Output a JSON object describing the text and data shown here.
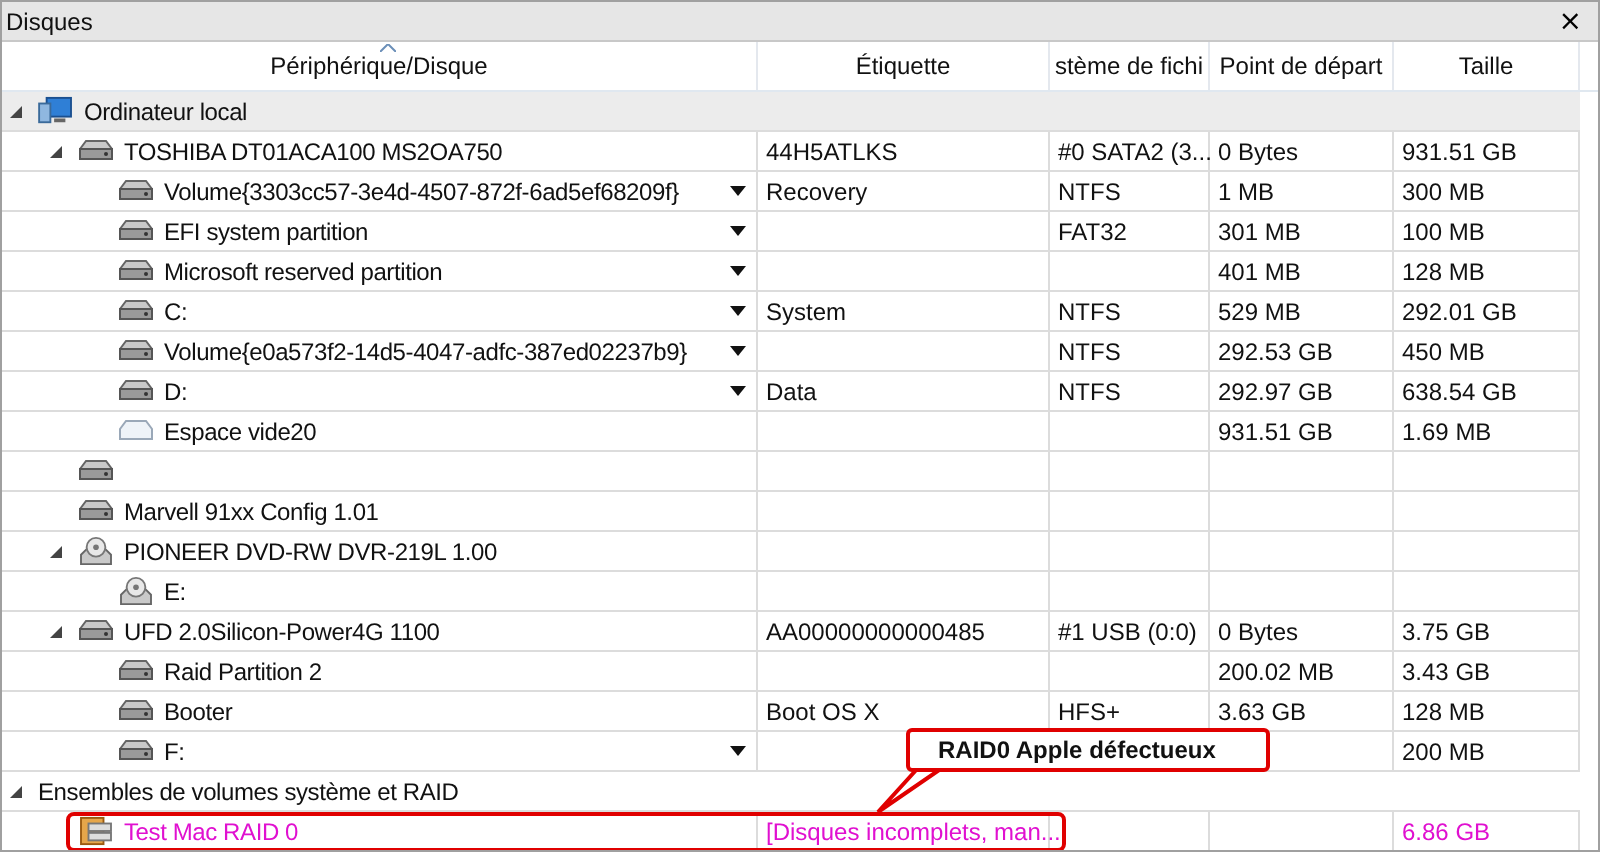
{
  "window": {
    "title": "Disques",
    "close": "×"
  },
  "columns": [
    {
      "label": "Périphérique/Disque",
      "sorted": true
    },
    {
      "label": "Étiquette",
      "sorted": false
    },
    {
      "label": "stème de fichi",
      "sorted": false
    },
    {
      "label": "Point de départ",
      "sorted": false
    },
    {
      "label": "Taille",
      "sorted": false
    }
  ],
  "tree": [
    {
      "kind": "computer",
      "name": "Ordinateur local",
      "selected": true,
      "expanded": true,
      "children": [
        {
          "kind": "disk",
          "name": "TOSHIBA DT01ACA100 MS2OA750",
          "label": "44H5ATLKS",
          "column_3": "#0 SATA2 (3...",
          "start": "0 Bytes",
          "size": "931.51 GB",
          "expanded": true,
          "children": [
            {
              "kind": "disk",
              "name": "Volume{3303cc57-3e4d-4507-872f-6ad5ef68209f}",
              "dropdown": true,
              "label": "Recovery",
              "column_3": "NTFS",
              "start": "1 MB",
              "size": "300 MB"
            },
            {
              "kind": "disk",
              "name": "EFI system partition",
              "dropdown": true,
              "column_3": "FAT32",
              "start": "301 MB",
              "size": "100 MB"
            },
            {
              "kind": "disk",
              "name": "Microsoft reserved partition",
              "dropdown": true,
              "start": "401 MB",
              "size": "128 MB"
            },
            {
              "kind": "disk",
              "name": "C:",
              "dropdown": true,
              "label": "System",
              "column_3": "NTFS",
              "start": "529 MB",
              "size": "292.01 GB"
            },
            {
              "kind": "disk",
              "name": "Volume{e0a573f2-14d5-4047-adfc-387ed02237b9}",
              "dropdown": true,
              "column_3": "NTFS",
              "start": "292.53 GB",
              "size": "450 MB"
            },
            {
              "kind": "disk",
              "name": "D:",
              "dropdown": true,
              "label": "Data",
              "column_3": "NTFS",
              "start": "292.97 GB",
              "size": "638.54 GB"
            },
            {
              "kind": "space",
              "name": "Espace vide20",
              "start": "931.51 GB",
              "size": "1.69 MB"
            }
          ]
        },
        {
          "kind": "disk"
        },
        {
          "kind": "disk",
          "name": "Marvell 91xx Config 1.01"
        },
        {
          "kind": "optical",
          "name": "PIONEER DVD-RW DVR-219L 1.00",
          "expanded": true,
          "children": [
            {
              "kind": "optical",
              "name": "E:"
            }
          ]
        },
        {
          "kind": "disk",
          "name": "UFD 2.0Silicon-Power4G 1100",
          "label": "AA00000000000485",
          "column_3": "#1 USB (0:0)",
          "start": "0 Bytes",
          "size": "3.75 GB",
          "expanded": true,
          "children": [
            {
              "kind": "disk",
              "name": "Raid Partition 2",
              "start": "200.02 MB",
              "size": "3.43 GB"
            },
            {
              "kind": "disk",
              "name": "Booter",
              "label": "Boot OS X",
              "column_3": "HFS+",
              "start": "3.63 GB",
              "size": "128 MB"
            },
            {
              "kind": "disk",
              "name": "F:",
              "dropdown": true,
              "size": "200 MB"
            }
          ]
        }
      ]
    },
    {
      "kind": "group",
      "name": "Ensembles de volumes système et RAID",
      "selected": false,
      "expanded": true,
      "children": [
        {
          "kind": "raid",
          "name": "Test Mac RAID 0",
          "error": true,
          "outlined": true,
          "label": "[Disques incomplets, man...",
          "size": "6.86 GB"
        }
      ]
    }
  ],
  "callout": {
    "text": "RAID0 Apple défectueux"
  }
}
